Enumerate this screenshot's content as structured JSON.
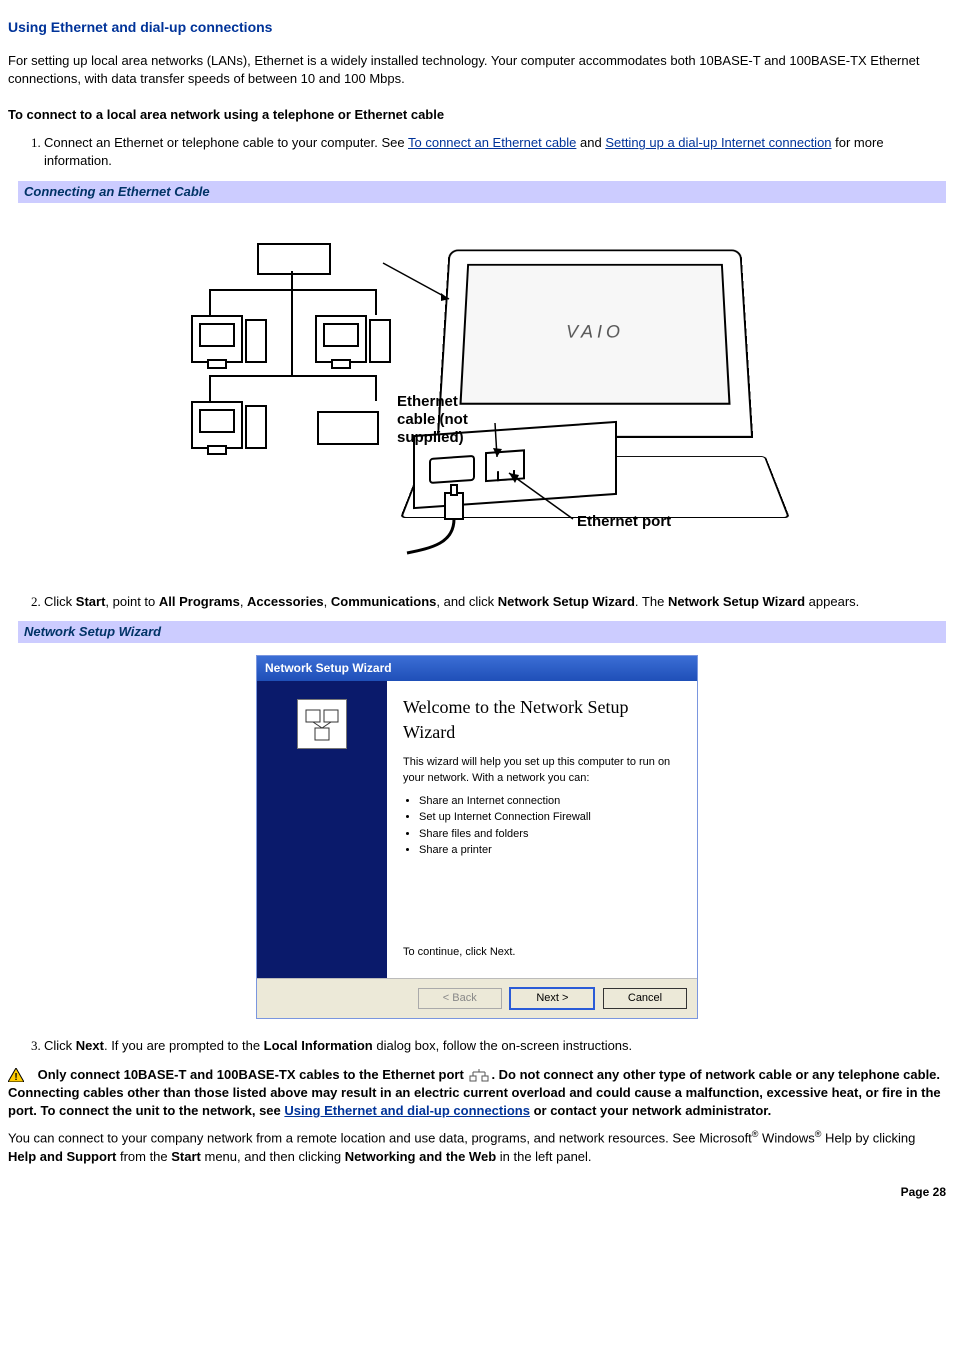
{
  "title": "Using Ethernet and dial-up connections",
  "intro": "For setting up local area networks (LANs), Ethernet is a widely installed technology. Your computer accommodates both 10BASE-T and 100BASE-TX Ethernet connections, with data transfer speeds of between 10 and 100 Mbps.",
  "subhead": "To connect to a local area network using a telephone or Ethernet cable",
  "step1_pre": "Connect an Ethernet or telephone cable to your computer. See ",
  "step1_link1": "To connect an Ethernet cable",
  "step1_mid": " and ",
  "step1_link2": "Setting up a dial-up Internet connection",
  "step1_post": " for more information.",
  "fig1_caption": "Connecting an Ethernet Cable",
  "fig1_label_cable": "Ethernet cable (not supplied)",
  "fig1_label_port": "Ethernet port",
  "fig1_logo": "VAIO",
  "step2_a": "Click ",
  "step2_b": "Start",
  "step2_c": ", point to ",
  "step2_d": "All Programs",
  "step2_e": ", ",
  "step2_f": "Accessories",
  "step2_g": ", ",
  "step2_h": "Communications",
  "step2_i": ", and click ",
  "step2_j": "Network Setup Wizard",
  "step2_k": ". The ",
  "step2_l": "Network Setup Wizard",
  "step2_m": " appears.",
  "fig2_caption": "Network Setup Wizard",
  "wizard": {
    "titlebar": "Network Setup Wizard",
    "heading": "Welcome to the Network Setup Wizard",
    "para1": "This wizard will help you set up this computer to run on your network. With a network you can:",
    "bullets": [
      "Share an Internet connection",
      "Set up Internet Connection Firewall",
      "Share files and folders",
      "Share a printer"
    ],
    "continue_text": "To continue, click Next.",
    "btn_back": "< Back",
    "btn_next": "Next >",
    "btn_cancel": "Cancel"
  },
  "step3_a": "Click ",
  "step3_b": "Next",
  "step3_c": ". If you are prompted to the ",
  "step3_d": "Local Information",
  "step3_e": " dialog box, follow the on-screen instructions.",
  "warning": {
    "pre": "Only connect 10BASE-T and 100BASE-TX cables to the Ethernet port ",
    "post": ". Do not connect any other type of network cable or any telephone cable. Connecting cables other than those listed above may result in an electric current overload and could cause a malfunction, excessive heat, or fire in the port. To connect the unit to the network, see ",
    "link": "Using Ethernet and dial-up connections",
    "tail": " or contact your network administrator."
  },
  "closing_a": "You can connect to your company network from a remote location and use data, programs, and network resources. See Microsoft",
  "closing_b": " Windows",
  "closing_c": " Help by clicking ",
  "closing_d": "Help and Support",
  "closing_e": " from the ",
  "closing_f": "Start",
  "closing_g": " menu, and then clicking ",
  "closing_h": "Networking and the Web",
  "closing_i": " in the left panel.",
  "page_number": "Page 28",
  "reg_mark": "®"
}
